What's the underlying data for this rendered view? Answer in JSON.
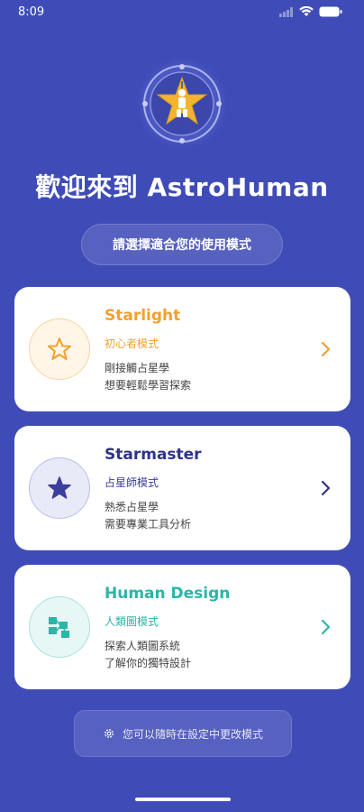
{
  "status": {
    "time": "8:09"
  },
  "header": {
    "title": "歡迎來到 AstroHuman",
    "subtitle": "請選擇適合您的使用模式"
  },
  "modes": [
    {
      "title": "Starlight",
      "mode_label": "初心者模式",
      "desc_line1": "剛接觸占星學",
      "desc_line2": "想要輕鬆學習探索",
      "icon": "star-outline-icon",
      "accent": "#f3a12b"
    },
    {
      "title": "Starmaster",
      "mode_label": "占星師模式",
      "desc_line1": "熟悉占星學",
      "desc_line2": "需要專業工具分析",
      "icon": "star-filled-icon",
      "accent": "#3a3e9c"
    },
    {
      "title": "Human Design",
      "mode_label": "人類圖模式",
      "desc_line1": "探索人類圖系統",
      "desc_line2": "了解你的獨特設計",
      "icon": "bodygraph-icon",
      "accent": "#2bb5a7"
    }
  ],
  "footer": {
    "note": "您可以隨時在設定中更改模式",
    "icon": "gear-icon"
  },
  "colors": {
    "background": "#3f4cb8",
    "card": "#ffffff"
  }
}
